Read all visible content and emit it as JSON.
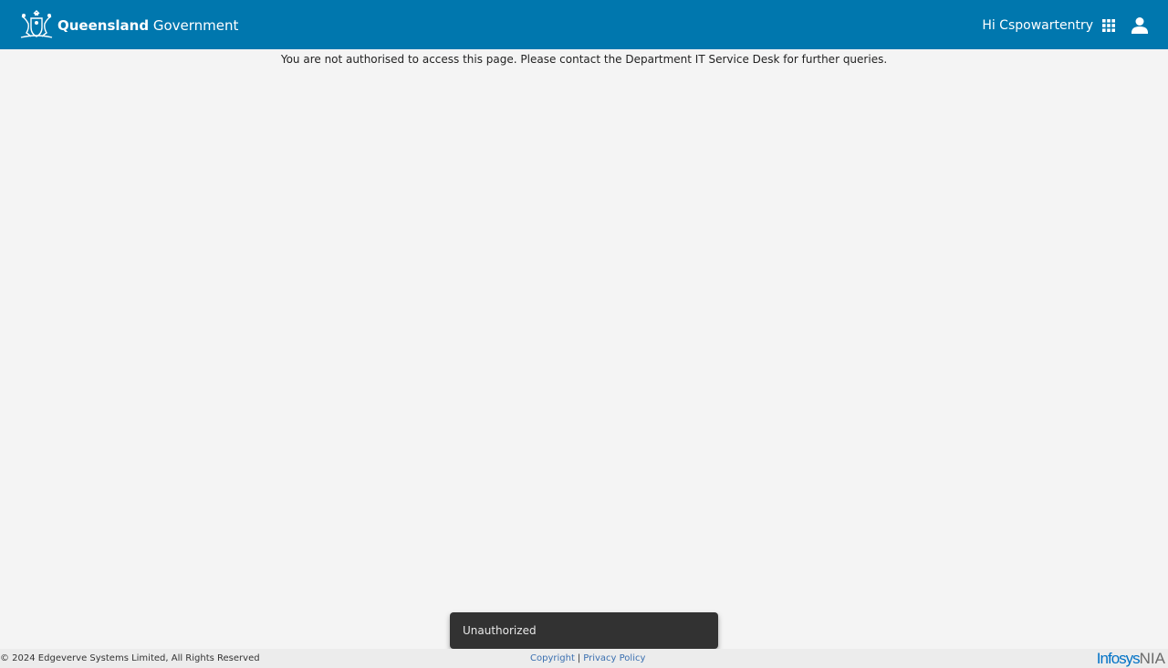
{
  "header": {
    "brand_bold": "Queensland",
    "brand_regular": "Government",
    "greeting": "Hi Cspowartentry",
    "background_color": "#0077ae",
    "logo_icon": "coat-of-arms-icon",
    "apps_icon": "apps-grid-icon",
    "user_icon": "user-account-icon"
  },
  "main": {
    "message": "You are not authorised to access this page. Please contact the Department IT Service Desk for further queries."
  },
  "toast": {
    "text": "Unauthorized"
  },
  "footer": {
    "copyright_text": "© 2024 Edgeverve Systems Limited, All Rights Reserved",
    "copyright_link": "Copyright",
    "separator": "|",
    "privacy_link": "Privacy Policy",
    "logo_infosys": "Infosys",
    "logo_nia": "NIA"
  }
}
